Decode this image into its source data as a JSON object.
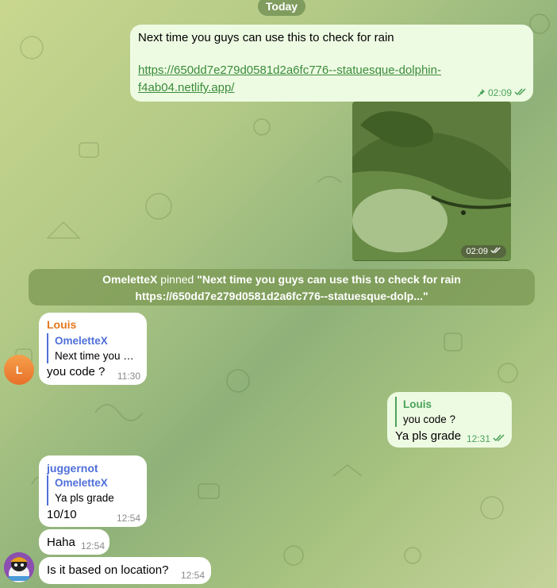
{
  "date_separator": "Today",
  "colors": {
    "outgoing_bubble": "#eefbe3",
    "incoming_bubble": "#ffffff",
    "link": "#3a8c3a",
    "louis_name": "#e6761b",
    "omelettex_name": "#4f6fd8",
    "juggernot_name": "#4f6fd8"
  },
  "messages": {
    "m1": {
      "text": "Next time you guys can use this to check for rain",
      "link_line1": "https://650dd7e279d0581d2a6fc776--statuesque-dolphin-",
      "link_line2": "f4ab04.netlify.app/",
      "time": "02:09",
      "pinned_icon": "pin-icon",
      "status": "read"
    },
    "sticker": {
      "time": "02:09",
      "status": "read"
    },
    "m3": {
      "sender": "Louis",
      "reply_name": "OmeletteX",
      "reply_text": "Next time you …",
      "text": "you code ?",
      "time": "11:30",
      "avatar_letter": "L"
    },
    "m4": {
      "reply_name": "Louis",
      "reply_text": "you code ?",
      "text": "Ya pls grade",
      "time": "12:31",
      "status": "read"
    },
    "m5": {
      "sender": "juggernot",
      "reply_name": "OmeletteX",
      "reply_text": "Ya pls grade",
      "text": "10/10",
      "time": "12:54"
    },
    "m6": {
      "text": "Haha",
      "time": "12:54"
    },
    "m7": {
      "text": "Is it based on location?",
      "time": "12:54"
    }
  },
  "pinned_notice": {
    "actor": "OmeletteX",
    "verb": " pinned ",
    "line1": "\"Next time you guys can use this to check for rain",
    "line2": "https://650dd7e279d0581d2a6fc776--statuesque-dolp...\""
  }
}
